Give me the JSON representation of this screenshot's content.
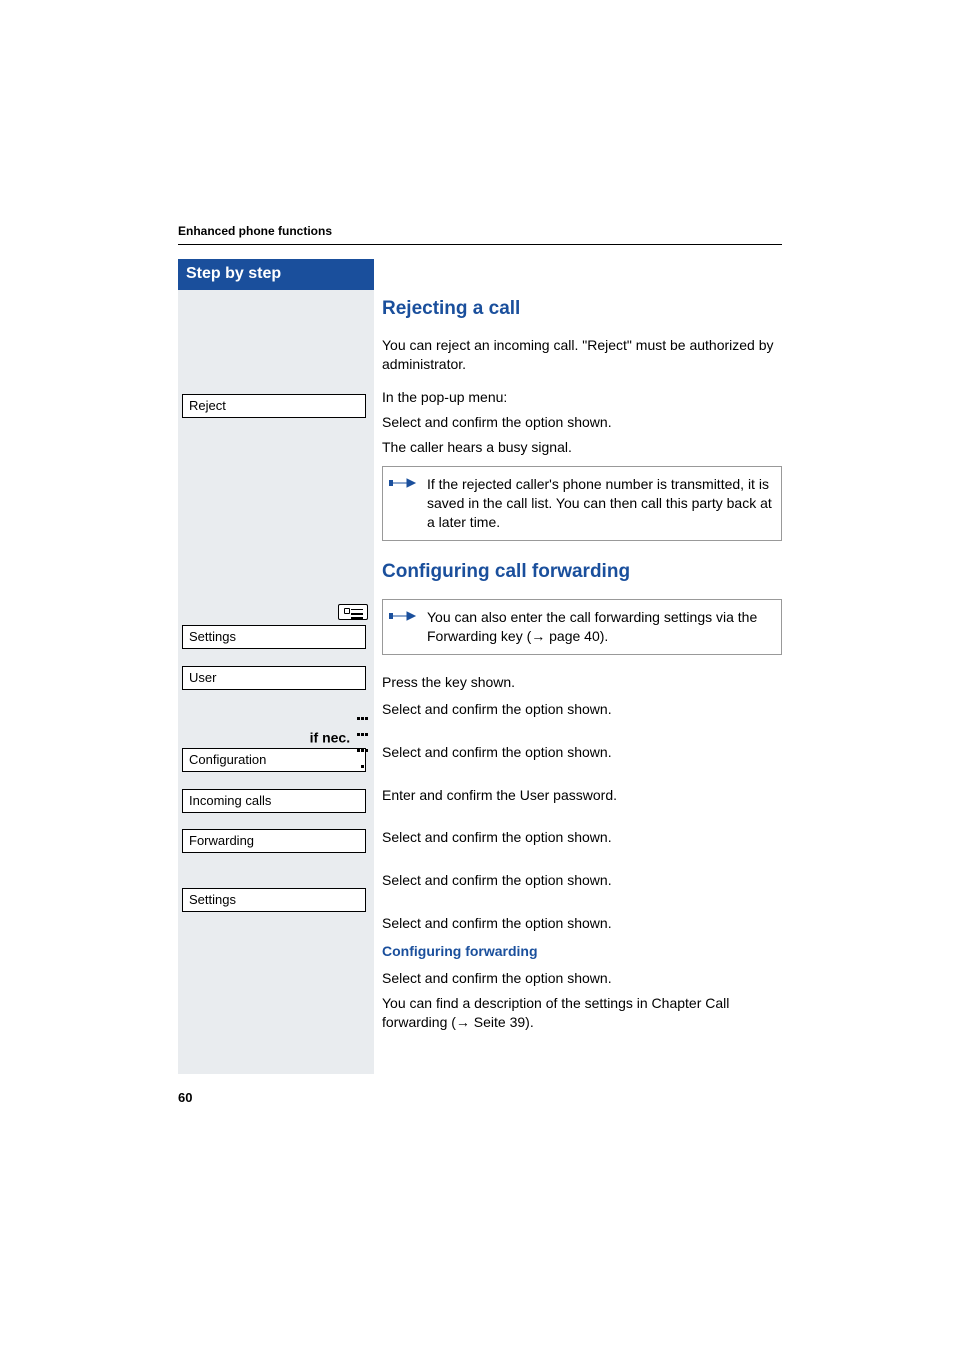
{
  "header": {
    "running_title": "Enhanced phone functions"
  },
  "sidebar": {
    "title": "Step by step"
  },
  "menu_items": {
    "reject": "Reject",
    "settings1": "Settings",
    "user": "User",
    "configuration": "Configuration",
    "incoming_calls": "Incoming calls",
    "forwarding": "Forwarding",
    "settings2": "Settings"
  },
  "labels": {
    "if_nec": "if nec."
  },
  "sections": {
    "rejecting": {
      "heading": "Rejecting a call",
      "p1": "You can reject an incoming call. \"Reject\" must be authorized by administrator.",
      "p2": "In the pop-up menu:",
      "p3a": "Select and confirm the option shown.",
      "p3b": "The caller hears a busy signal.",
      "note": "If the rejected caller's phone number is transmitted, it is saved in the call list. You can then call this party back at a later time."
    },
    "config_fwd": {
      "heading": "Configuring call forwarding",
      "note": "You can also enter the call forwarding settings via the Forwarding key (→ page 40).",
      "p_press": "Press the key shown.",
      "p_sel1": "Select and confirm the option shown.",
      "p_sel2": "Select and confirm the option shown.",
      "p_pwd": "Enter and confirm the User password.",
      "p_sel3": "Select and confirm the option shown.",
      "p_sel4": "Select and confirm the option shown.",
      "p_sel5": "Select and confirm the option shown.",
      "sub_heading": "Configuring forwarding",
      "p_sel6": "Select and confirm the option shown.",
      "p_desc": "You can find a description of the settings in Chapter Call forwarding (→ Seite 39)."
    }
  },
  "page_number": "60"
}
